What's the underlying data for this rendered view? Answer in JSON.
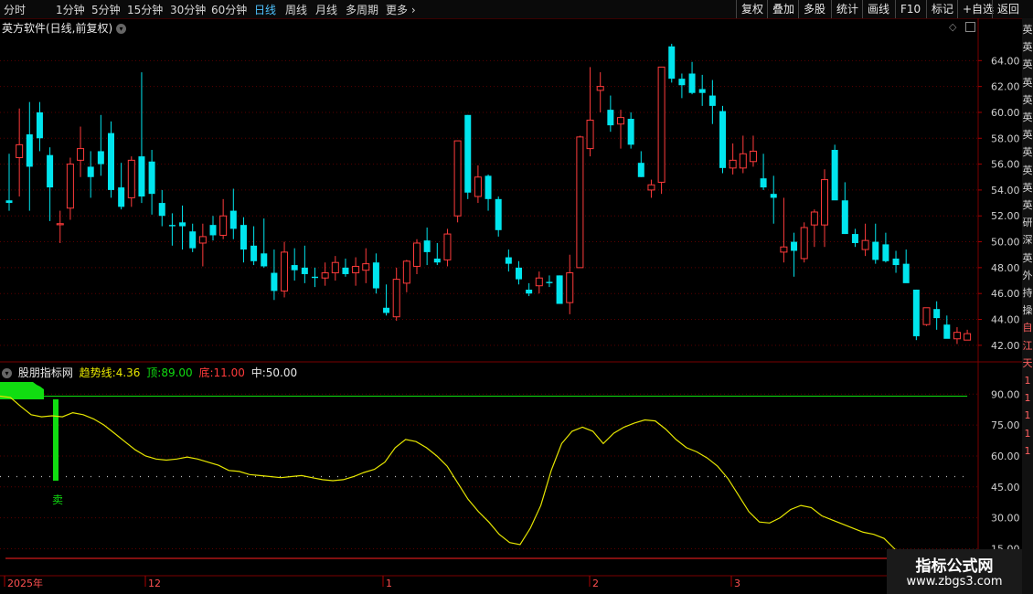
{
  "toolbar": {
    "periods": [
      "分时",
      "1分钟",
      "5分钟",
      "15分钟",
      "30分钟",
      "60分钟",
      "日线",
      "周线",
      "月线",
      "多周期"
    ],
    "active_period": "日线",
    "more_label": "更多",
    "right_buttons": [
      "复权",
      "叠加",
      "多股",
      "统计",
      "画线",
      "F10",
      "标记",
      "+自选",
      "返回"
    ]
  },
  "main_chart": {
    "title": "英方软件(日线,前复权)",
    "price_ticks": [
      "64.00",
      "62.00",
      "60.00",
      "58.00",
      "56.00",
      "54.00",
      "52.00",
      "50.00",
      "48.00",
      "46.00",
      "44.00",
      "42.00"
    ]
  },
  "indicator": {
    "name": "股朋指标网",
    "trend_label": "趋势线:",
    "trend_value": "4.36",
    "top_label": "顶:",
    "top_value": "89.00",
    "bottom_label": "底:",
    "bottom_value": "11.00",
    "mid_label": "中:",
    "mid_value": "50.00",
    "sell_label": "卖",
    "ticks": [
      "90.00",
      "75.00",
      "60.00",
      "45.00",
      "30.00",
      "15.00"
    ]
  },
  "time_axis": {
    "labels": [
      "2025年",
      "12",
      "1",
      "2",
      "3"
    ]
  },
  "sidebar": {
    "chips": [
      "英",
      "英",
      "英",
      "英",
      "英",
      "英",
      "英",
      "英",
      "英",
      "英",
      "英",
      "研",
      "深",
      "英",
      "外",
      "持",
      "操",
      "自",
      "江",
      "天",
      "1",
      "1",
      "1",
      "1",
      "1"
    ]
  },
  "watermark": {
    "line1": "指标公式网",
    "line2": "www.zbgs3.com"
  },
  "colors": {
    "up": "#ff3b3b",
    "down": "#00e5ee",
    "trend": "#e6e600",
    "top_line": "#11dd11",
    "bottom_line": "#ff2020",
    "active_tab": "#4fc3ff"
  },
  "chart_data": {
    "type": "candlestick",
    "y_range": [
      41,
      66
    ],
    "candles": [
      [
        53.2,
        56.8,
        52.4,
        53.0
      ],
      [
        56.5,
        60.3,
        53.5,
        57.5
      ],
      [
        58.3,
        60.8,
        52.4,
        55.8
      ],
      [
        60.0,
        60.8,
        57.0,
        58.0
      ],
      [
        56.7,
        57.3,
        51.6,
        54.2
      ],
      [
        51.4,
        52.4,
        49.9,
        51.4
      ],
      [
        52.6,
        56.5,
        51.7,
        56.0
      ],
      [
        56.3,
        58.9,
        55.0,
        57.2
      ],
      [
        55.8,
        57.0,
        53.4,
        55.0
      ],
      [
        57.0,
        59.8,
        55.1,
        56.0
      ],
      [
        58.4,
        59.3,
        53.4,
        54.0
      ],
      [
        54.2,
        56.1,
        52.5,
        52.7
      ],
      [
        53.4,
        56.6,
        52.7,
        56.3
      ],
      [
        56.6,
        63.1,
        53.0,
        53.5
      ],
      [
        56.2,
        57.1,
        52.1,
        53.7
      ],
      [
        53.0,
        54.0,
        51.2,
        52.0
      ],
      [
        51.3,
        52.2,
        49.7,
        51.2
      ],
      [
        51.5,
        52.8,
        49.4,
        51.2
      ],
      [
        50.8,
        51.4,
        49.2,
        49.5
      ],
      [
        49.9,
        51.4,
        48.1,
        50.4
      ],
      [
        51.3,
        52.0,
        50.1,
        50.5
      ],
      [
        50.5,
        53.3,
        50.2,
        52.0
      ],
      [
        52.4,
        54.1,
        50.2,
        51.0
      ],
      [
        51.3,
        51.9,
        48.4,
        49.4
      ],
      [
        49.7,
        51.2,
        48.2,
        48.5
      ],
      [
        49.1,
        51.8,
        48.0,
        48.1
      ],
      [
        47.6,
        49.4,
        45.5,
        46.2
      ],
      [
        46.2,
        50.0,
        45.7,
        49.2
      ],
      [
        48.2,
        49.5,
        47.0,
        47.8
      ],
      [
        48.0,
        49.7,
        46.8,
        47.5
      ],
      [
        47.3,
        48.0,
        46.5,
        47.2
      ],
      [
        47.2,
        48.4,
        46.6,
        47.6
      ],
      [
        47.6,
        48.9,
        47.0,
        48.4
      ],
      [
        48.0,
        48.7,
        47.3,
        47.5
      ],
      [
        47.6,
        48.8,
        46.6,
        48.1
      ],
      [
        47.8,
        49.5,
        46.8,
        48.3
      ],
      [
        48.4,
        49.1,
        46.0,
        46.4
      ],
      [
        44.9,
        46.7,
        44.3,
        44.5
      ],
      [
        44.2,
        48.0,
        43.9,
        47.1
      ],
      [
        46.8,
        48.6,
        46.1,
        48.5
      ],
      [
        48.1,
        50.2,
        47.5,
        49.9
      ],
      [
        50.1,
        51.1,
        48.2,
        49.2
      ],
      [
        48.7,
        49.9,
        48.2,
        48.4
      ],
      [
        48.6,
        51.0,
        48.1,
        50.6
      ],
      [
        52.0,
        56.6,
        51.5,
        57.8
      ],
      [
        59.8,
        59.8,
        53.3,
        53.8
      ],
      [
        53.5,
        55.9,
        53.0,
        55.0
      ],
      [
        55.1,
        55.2,
        52.4,
        53.3
      ],
      [
        53.3,
        53.5,
        50.4,
        50.9
      ],
      [
        48.8,
        49.4,
        47.7,
        48.3
      ],
      [
        48.0,
        48.5,
        46.7,
        47.1
      ],
      [
        46.3,
        46.8,
        45.8,
        46.0
      ],
      [
        46.6,
        47.7,
        46.0,
        47.2
      ],
      [
        46.9,
        47.4,
        46.5,
        46.8
      ],
      [
        47.4,
        47.4,
        45.9,
        45.2
      ],
      [
        45.3,
        49.0,
        44.4,
        47.6
      ],
      [
        48.0,
        58.2,
        48.0,
        58.1
      ],
      [
        57.2,
        63.5,
        56.6,
        59.4
      ],
      [
        61.7,
        63.1,
        60.0,
        62.0
      ],
      [
        60.2,
        61.3,
        58.5,
        59.0
      ],
      [
        59.1,
        60.2,
        57.2,
        59.6
      ],
      [
        59.5,
        60.0,
        57.2,
        57.5
      ],
      [
        56.1,
        57.0,
        55.0,
        55.0
      ],
      [
        54.0,
        54.8,
        53.4,
        54.4
      ],
      [
        54.6,
        61.2,
        53.7,
        63.5
      ],
      [
        65.1,
        65.3,
        62.3,
        62.6
      ],
      [
        62.6,
        63.0,
        61.1,
        62.1
      ],
      [
        63.0,
        63.9,
        61.4,
        61.5
      ],
      [
        61.8,
        62.9,
        60.5,
        61.5
      ],
      [
        61.3,
        62.5,
        59.1,
        60.5
      ],
      [
        60.1,
        60.5,
        55.3,
        55.7
      ],
      [
        55.7,
        57.6,
        55.2,
        56.3
      ],
      [
        55.7,
        58.2,
        55.3,
        56.8
      ],
      [
        56.2,
        58.2,
        55.8,
        57.0
      ],
      [
        54.9,
        56.8,
        54.0,
        54.2
      ],
      [
        53.7,
        55.1,
        51.4,
        53.4
      ],
      [
        49.2,
        53.4,
        48.4,
        49.6
      ],
      [
        50.0,
        50.7,
        47.3,
        49.3
      ],
      [
        48.7,
        51.5,
        48.4,
        51.1
      ],
      [
        51.3,
        52.5,
        49.6,
        52.3
      ],
      [
        51.3,
        55.6,
        49.6,
        54.8
      ],
      [
        57.1,
        57.5,
        53.5,
        53.2
      ],
      [
        53.2,
        54.6,
        50.6,
        50.6
      ],
      [
        50.6,
        51.0,
        49.6,
        49.9
      ],
      [
        49.4,
        51.4,
        48.9,
        50.1
      ],
      [
        50.0,
        51.4,
        48.3,
        48.6
      ],
      [
        49.8,
        50.7,
        48.4,
        48.5
      ],
      [
        48.7,
        49.3,
        47.6,
        48.2
      ],
      [
        48.3,
        49.4,
        46.9,
        46.8
      ],
      [
        46.3,
        46.3,
        42.4,
        42.7
      ],
      [
        43.6,
        44.8,
        43.5,
        44.9
      ],
      [
        44.8,
        45.4,
        43.2,
        44.1
      ],
      [
        43.6,
        44.3,
        42.8,
        42.5
      ],
      [
        42.5,
        43.4,
        42.1,
        43.0
      ],
      [
        42.4,
        43.2,
        42.4,
        42.9
      ]
    ],
    "indicator": {
      "y_range": [
        13,
        95
      ],
      "top": 89,
      "bottom": 11,
      "mid": 50,
      "trend_line": [
        89,
        88.4,
        84,
        80,
        79,
        79.5,
        79,
        81,
        80,
        78,
        75,
        71,
        67,
        63,
        60,
        58.5,
        58,
        58.5,
        59.5,
        58.5,
        57,
        55.5,
        53,
        52.5,
        51,
        50.5,
        50,
        49.5,
        50,
        50.5,
        49.5,
        48.5,
        48,
        48.5,
        50,
        52,
        53.5,
        57,
        64,
        68,
        67,
        64,
        60,
        55,
        47,
        39,
        33,
        28,
        22,
        18,
        17,
        25,
        36,
        53,
        66,
        72,
        74,
        72,
        66,
        71,
        74,
        76,
        77.5,
        77,
        73,
        68,
        64,
        62,
        59,
        55,
        49,
        41,
        33,
        28,
        27.5,
        30,
        34,
        36,
        35,
        31,
        29,
        27,
        25,
        23,
        22,
        20,
        15,
        10,
        9,
        8.5,
        8,
        7,
        6.5,
        6
      ]
    }
  }
}
